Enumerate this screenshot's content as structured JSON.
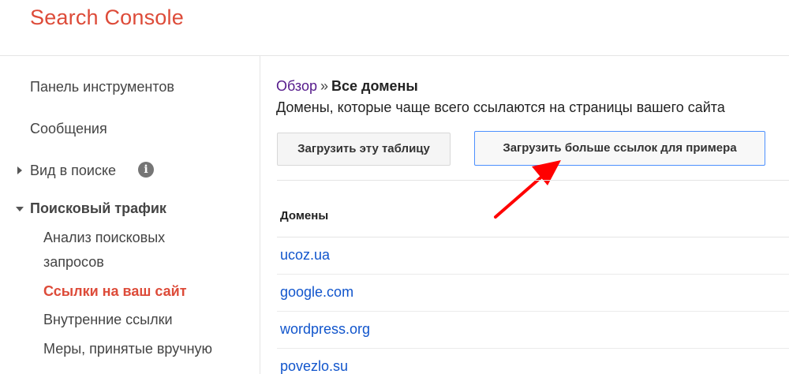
{
  "header": {
    "app_title": "Search Console"
  },
  "sidebar": {
    "items": [
      {
        "label": "Панель инструментов"
      },
      {
        "label": "Сообщения"
      },
      {
        "label": "Вид в поиске",
        "info_icon": "i"
      },
      {
        "label": "Поисковый трафик"
      }
    ],
    "subitems": [
      {
        "label": "Анализ поисковых"
      },
      {
        "label": "запросов"
      },
      {
        "label": "Ссылки на ваш сайт"
      },
      {
        "label": "Внутренние ссылки"
      },
      {
        "label": "Меры, принятые вручную"
      }
    ]
  },
  "main": {
    "breadcrumb": {
      "link": "Обзор",
      "separator": "»",
      "current": "Все домены"
    },
    "subtitle": "Домены, которые чаще всего ссылаются на страницы вашего сайта",
    "buttons": {
      "download_table": "Загрузить эту таблицу",
      "download_more": "Загрузить больше ссылок для примера"
    },
    "table": {
      "column_header": "Домены",
      "rows": [
        {
          "domain": "ucoz.ua"
        },
        {
          "domain": "google.com"
        },
        {
          "domain": "wordpress.org"
        },
        {
          "domain": "povezlo.su"
        }
      ]
    }
  },
  "colors": {
    "brand": "#dd4b39",
    "link": "#1155cc",
    "visited_link": "#551a8b",
    "button_focus_border": "#4d90fe",
    "annotation_arrow": "#ff0000"
  },
  "icons": [
    "expand-right-triangle-icon",
    "collapse-down-triangle-icon",
    "info-icon",
    "red-arrow-annotation"
  ]
}
